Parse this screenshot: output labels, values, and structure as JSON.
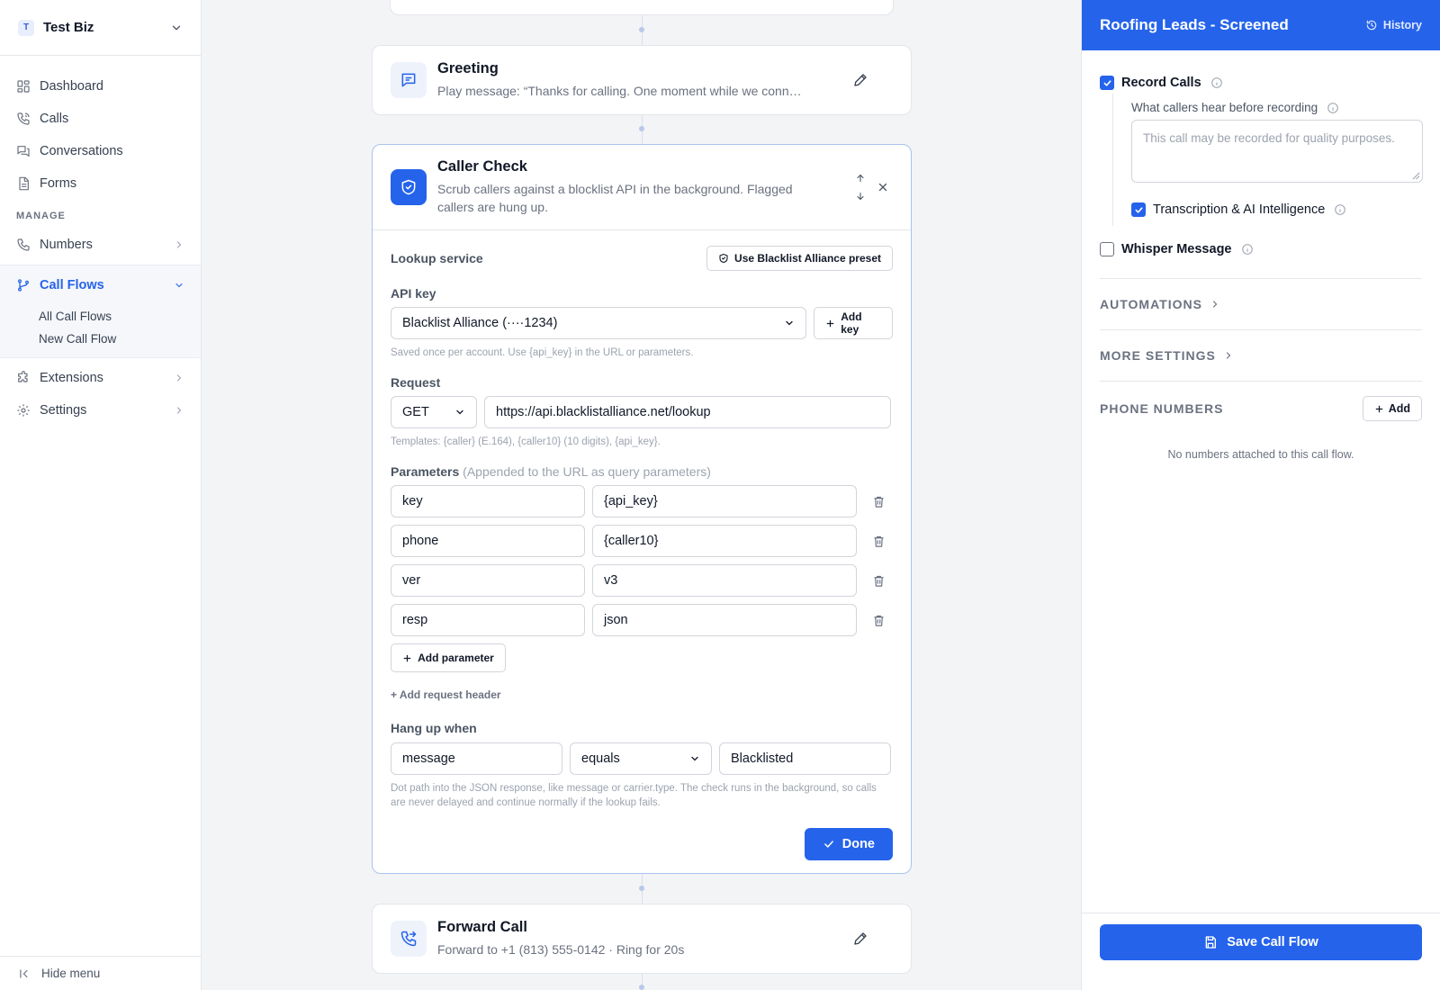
{
  "sidebar": {
    "business": {
      "initial": "T",
      "name": "Test Biz"
    },
    "nav": [
      {
        "label": "Dashboard",
        "icon": "dashboard-icon"
      },
      {
        "label": "Calls",
        "icon": "phone-icon"
      },
      {
        "label": "Conversations",
        "icon": "chat-icon"
      },
      {
        "label": "Forms",
        "icon": "form-icon"
      }
    ],
    "manage_label": "MANAGE",
    "manage": {
      "numbers": "Numbers",
      "call_flows": "Call Flows",
      "call_flows_sub": [
        "All Call Flows",
        "New Call Flow"
      ],
      "extensions": "Extensions",
      "settings": "Settings"
    },
    "hide_menu": "Hide menu"
  },
  "flow": {
    "greeting": {
      "title": "Greeting",
      "desc": "Play message: “Thanks for calling. One moment while we connect you.”"
    },
    "caller_check": {
      "title": "Caller Check",
      "desc": "Scrub callers against a blocklist API in the background. Flagged callers are hung up.",
      "lookup_label": "Lookup service",
      "preset_button": "Use Blacklist Alliance preset",
      "api_key_label": "API key",
      "api_key_value": "Blacklist Alliance (····1234)",
      "add_key_button": "Add key",
      "api_key_hint": "Saved once per account. Use {api_key} in the URL or parameters.",
      "request_label": "Request",
      "method": "GET",
      "url": "https://api.blacklistalliance.net/lookup",
      "request_hint": "Templates: {caller} (E.164), {caller10} (10 digits), {api_key}.",
      "params_label": "Parameters",
      "params_note": "(Appended to the URL as query parameters)",
      "params": [
        {
          "key": "key",
          "value": "{api_key}"
        },
        {
          "key": "phone",
          "value": "{caller10}"
        },
        {
          "key": "ver",
          "value": "v3"
        },
        {
          "key": "resp",
          "value": "json"
        }
      ],
      "add_param_button": "Add parameter",
      "add_header_link": "+ Add request header",
      "hangup_label": "Hang up when",
      "hangup_field": "message",
      "hangup_operator": "equals",
      "hangup_value": "Blacklisted",
      "hangup_hint": "Dot path into the JSON response, like message or carrier.type. The check runs in the background, so calls are never delayed and continue normally if the lookup fails.",
      "done_button": "Done"
    },
    "forward": {
      "title": "Forward Call",
      "desc": "Forward to +1 (813) 555-0142 · Ring for 20s"
    }
  },
  "panel": {
    "title": "Roofing Leads - Screened",
    "history": "History",
    "record_calls": {
      "label": "Record Calls",
      "checked": true
    },
    "pre_record_label": "What callers hear before recording",
    "pre_record_placeholder": "This call may be recorded for quality purposes.",
    "transcription": {
      "label": "Transcription & AI Intelligence",
      "checked": true
    },
    "whisper": {
      "label": "Whisper Message",
      "checked": false
    },
    "automations": "AUTOMATIONS",
    "more_settings": "MORE SETTINGS",
    "phone_numbers": "PHONE NUMBERS",
    "add_button": "Add",
    "no_numbers": "No numbers attached to this call flow.",
    "save_button": "Save Call Flow"
  },
  "colors": {
    "accent": "#2563eb",
    "panel_header": "#2563eb"
  }
}
